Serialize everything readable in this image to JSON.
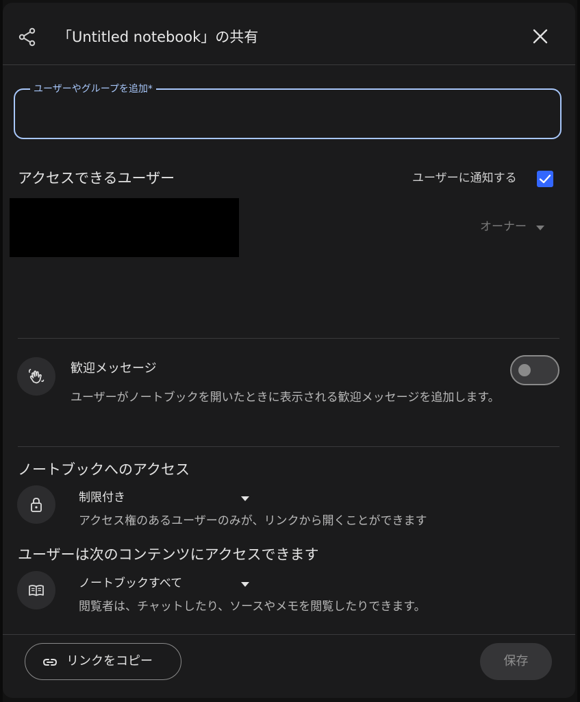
{
  "dialog": {
    "title": "「Untitled notebook」の共有",
    "share_icon": "share-icon",
    "close_icon": "close-icon"
  },
  "add_users": {
    "label": "ユーザーやグループを追加*",
    "value": "",
    "placeholder": ""
  },
  "access": {
    "heading": "アクセスできるユーザー",
    "notify_label": "ユーザーに通知する",
    "notify_checked": true,
    "owner_role": "オーナー"
  },
  "welcome": {
    "icon": "waving-hand-icon",
    "title": "歓迎メッセージ",
    "description": "ユーザーがノートブックを開いたときに表示される歓迎メッセージを追加します。",
    "enabled": false
  },
  "notebook_access": {
    "heading": "ノートブックへのアクセス",
    "icon": "lock-icon",
    "selected": "制限付き",
    "description": "アクセス権のあるユーザーのみが、リンクから開くことができます"
  },
  "content_access": {
    "heading": "ユーザーは次のコンテンツにアクセスできます",
    "icon": "book-icon",
    "selected": "ノートブックすべて",
    "description": "閲覧者は、チャットしたり、ソースやメモを閲覧したりできます。"
  },
  "footer": {
    "copy_link_label": "リンクをコピー",
    "copy_link_icon": "link-icon",
    "save_label": "保存"
  },
  "colors": {
    "accent": "#a8c7fa",
    "checkbox": "#3367ff",
    "surface": "#1b1b1c",
    "background": "#121212"
  }
}
